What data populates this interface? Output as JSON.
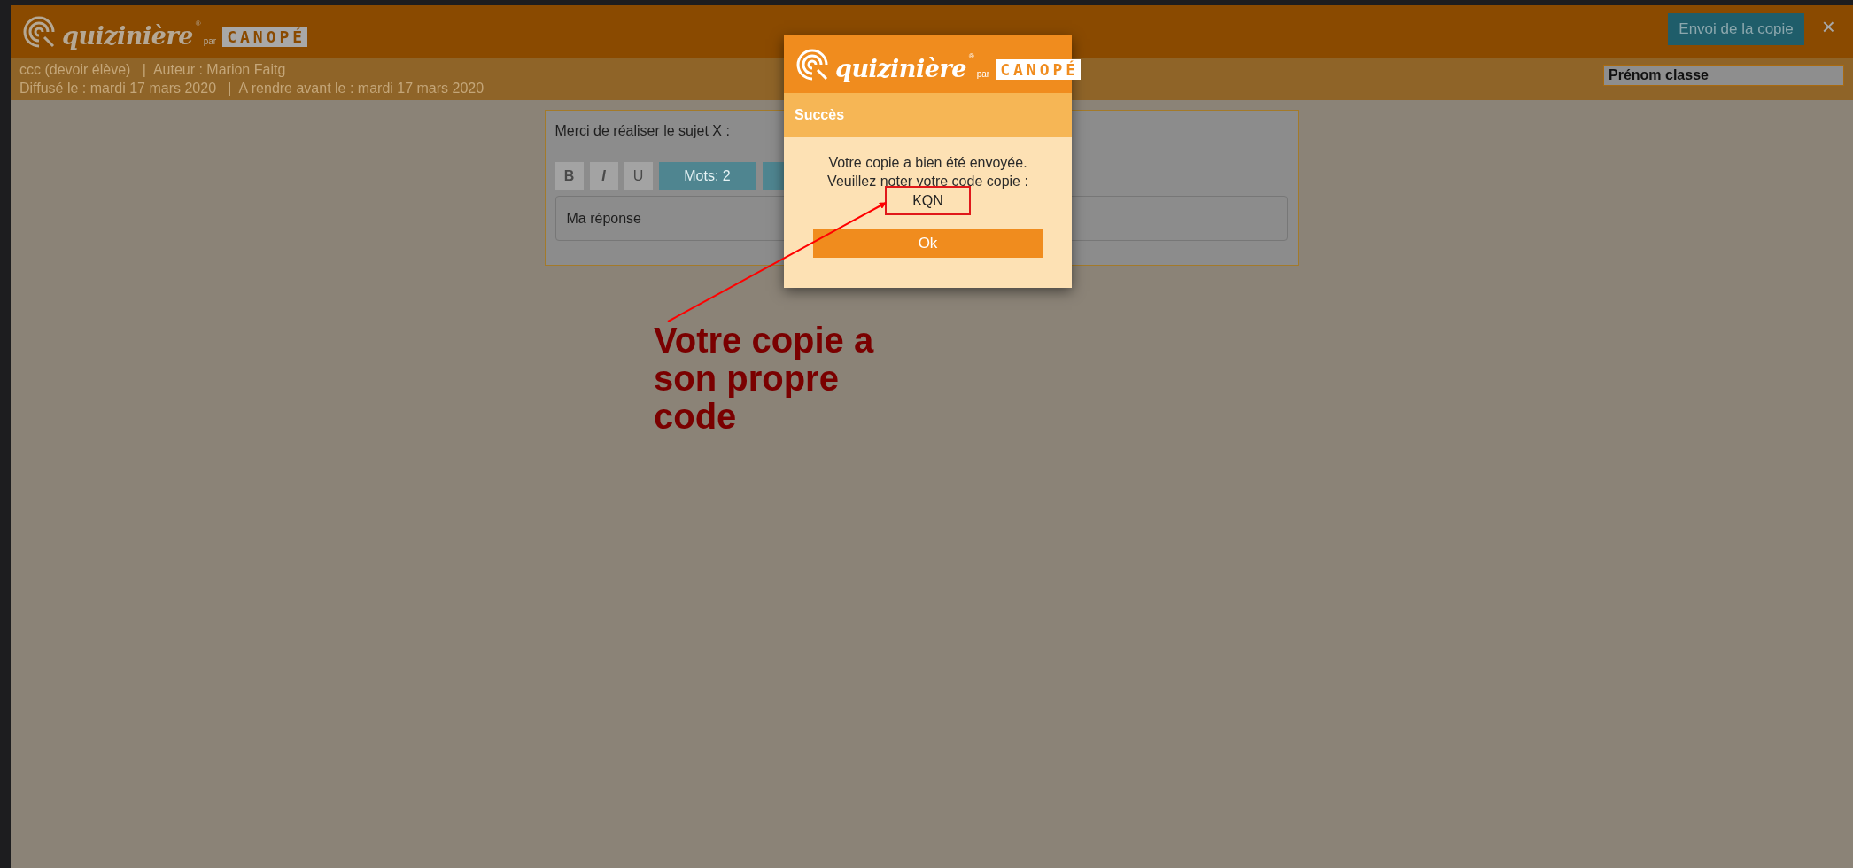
{
  "header": {
    "logo": {
      "wordmark": "quizinière",
      "registered": "®",
      "prefix": "par",
      "partner": "CANOPÉ"
    },
    "send_button": "Envoi de la copie",
    "close": "×"
  },
  "subheader": {
    "lines": [
      "ccc (devoir élève)   |  Auteur : Marion Faitg",
      "Diffusé le : mardi 17 mars 2020   |  A rendre avant le : mardi 17 mars 2020"
    ],
    "name_field": {
      "value": "Prénom classe"
    }
  },
  "question": {
    "prompt": "Merci de réaliser le sujet X :",
    "toolbar": [
      {
        "kind": "bold",
        "label": "B"
      },
      {
        "kind": "italic",
        "label": "I"
      },
      {
        "kind": "underline",
        "label": "U"
      },
      {
        "kind": "counter",
        "label": "Mots: 2"
      },
      {
        "kind": "counter"
      }
    ],
    "answer": {
      "value": "Ma réponse"
    }
  },
  "dialog": {
    "logo": {
      "wordmark": "quizinière",
      "registered": "®",
      "prefix": "par",
      "partner": "CANOPÉ"
    },
    "title": "Succès",
    "message": [
      "Votre copie a bien été envoyée.",
      "Veuillez noter votre code copie :"
    ],
    "code": "KQN",
    "ok_button": "Ok"
  },
  "annotation": {
    "text": "Votre copie a son propre code"
  }
}
